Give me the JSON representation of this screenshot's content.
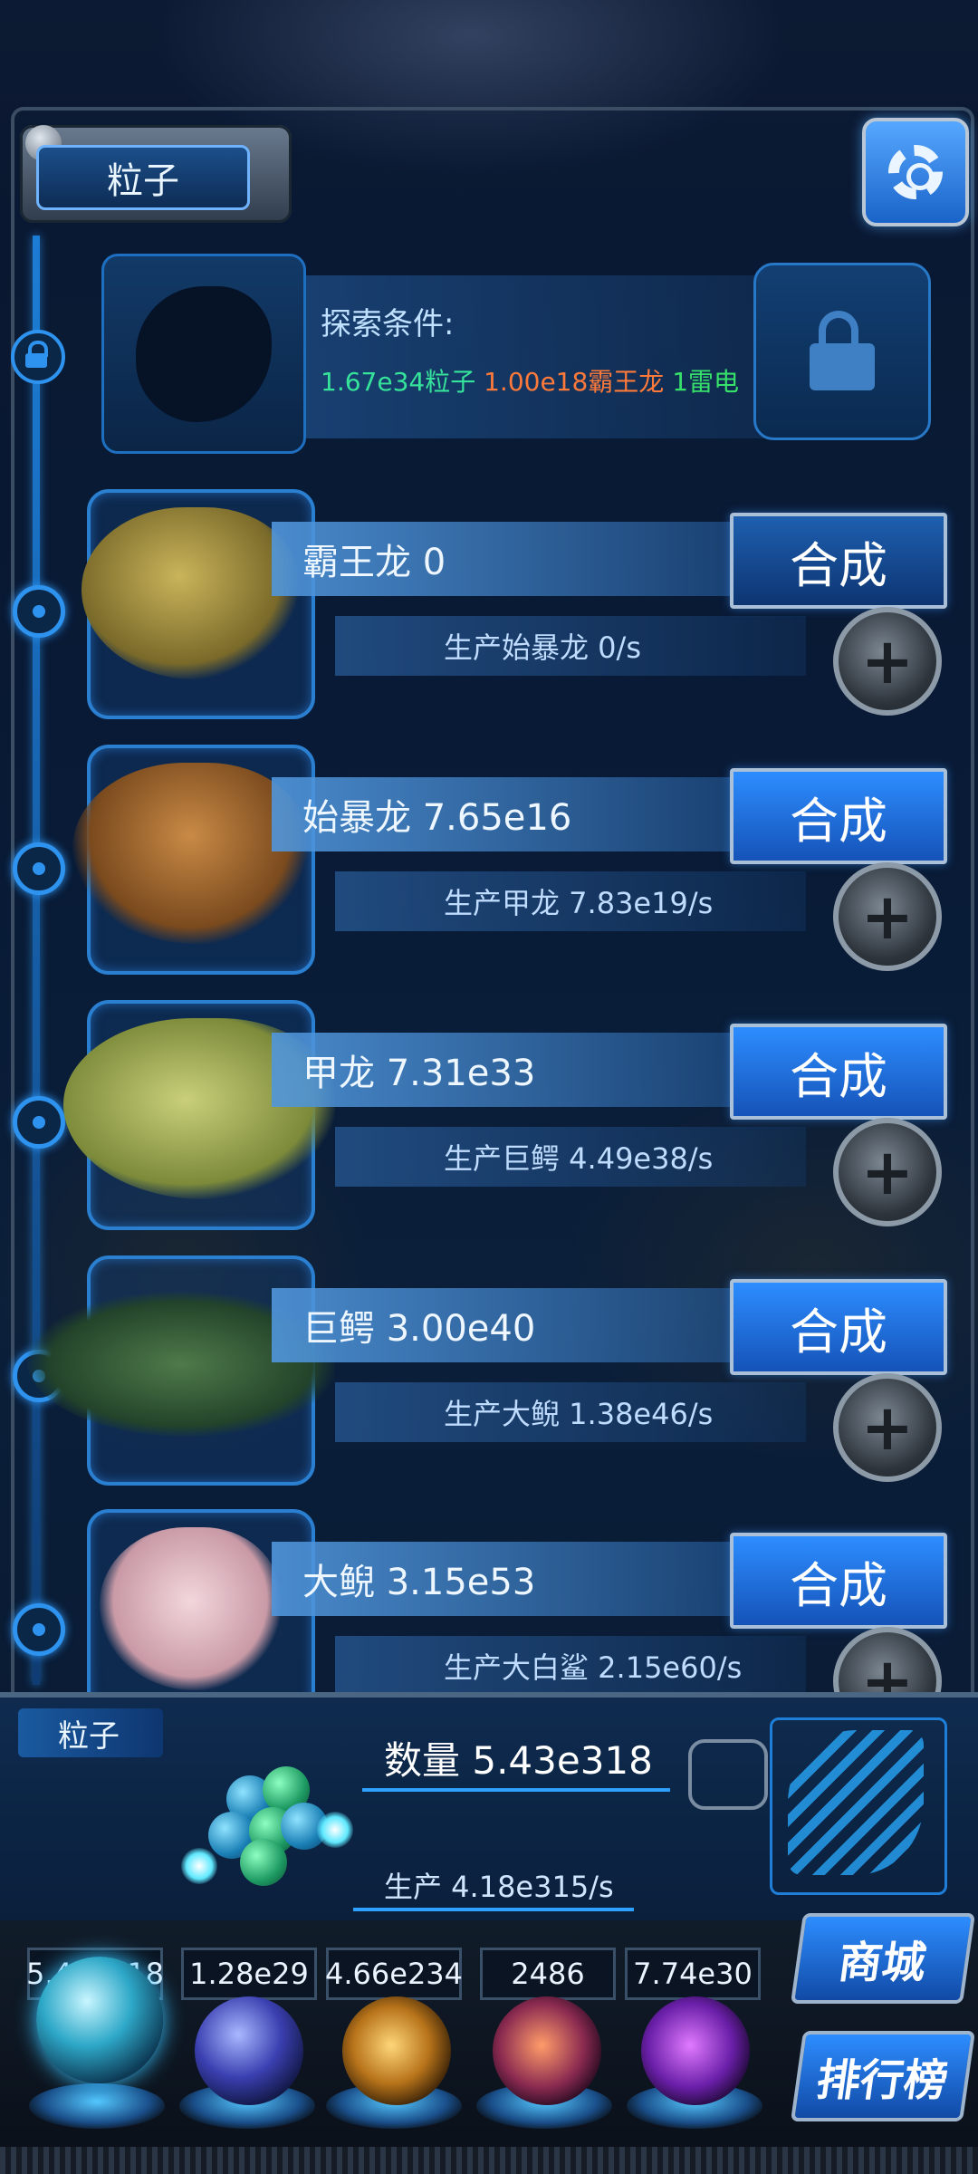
{
  "header": {
    "title": "粒子"
  },
  "explore": {
    "label": "探索条件:",
    "cost_particle": "1.67e34粒子",
    "cost_trex": "1.00e18霸王龙",
    "cost_thunder": "1雷电"
  },
  "creatures": [
    {
      "name": "霸王龙 0",
      "production": "生产始暴龙 0/s",
      "combine": "合成"
    },
    {
      "name": "始暴龙 7.65e16",
      "production": "生产甲龙 7.83e19/s",
      "combine": "合成"
    },
    {
      "name": "甲龙 7.31e33",
      "production": "生产巨鳄 4.49e38/s",
      "combine": "合成"
    },
    {
      "name": "巨鳄 3.00e40",
      "production": "生产大鲵 1.38e46/s",
      "combine": "合成"
    },
    {
      "name": "大鲵 3.15e53",
      "production": "生产大白鲨 2.15e60/s",
      "combine": "合成"
    }
  ],
  "bottom": {
    "tab": "粒子",
    "quantity": "数量 5.43e318",
    "production": "生产 4.18e315/s"
  },
  "resources": [
    "5.43e318",
    "1.28e29",
    "4.66e234",
    "2486",
    "7.74e30"
  ],
  "side_buttons": {
    "shop": "商城",
    "rank": "排行榜"
  },
  "colors": {
    "accent": "#2d8dff",
    "cost_green": "#35e39a",
    "cost_orange": "#ff7a3a"
  }
}
